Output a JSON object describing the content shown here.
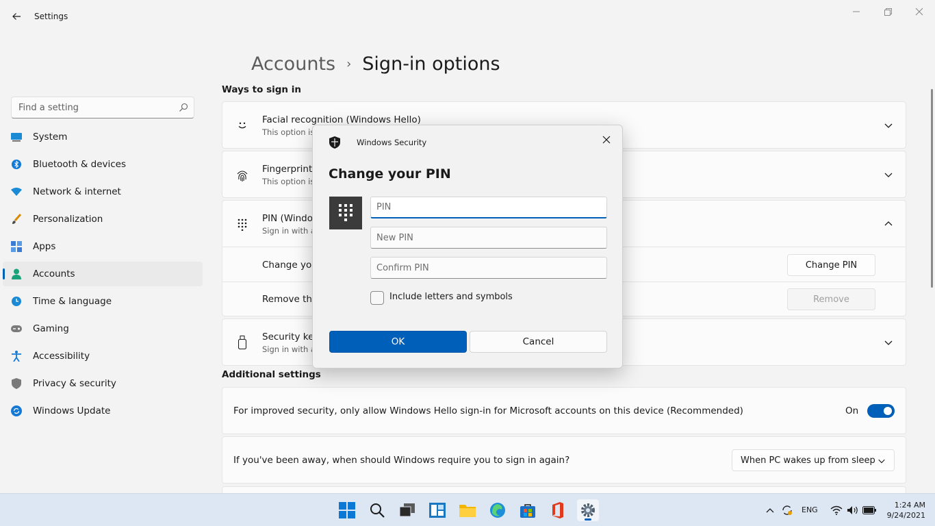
{
  "window": {
    "app_title": "Settings"
  },
  "sidebar": {
    "search_placeholder": "Find a setting",
    "items": [
      {
        "label": "System",
        "icon": "monitor-icon"
      },
      {
        "label": "Bluetooth & devices",
        "icon": "bluetooth-icon"
      },
      {
        "label": "Network & internet",
        "icon": "wifi-icon"
      },
      {
        "label": "Personalization",
        "icon": "brush-icon"
      },
      {
        "label": "Apps",
        "icon": "apps-icon"
      },
      {
        "label": "Accounts",
        "icon": "person-icon",
        "active": true
      },
      {
        "label": "Time & language",
        "icon": "clock-globe-icon"
      },
      {
        "label": "Gaming",
        "icon": "gamepad-icon"
      },
      {
        "label": "Accessibility",
        "icon": "accessibility-icon"
      },
      {
        "label": "Privacy & security",
        "icon": "shield-icon"
      },
      {
        "label": "Windows Update",
        "icon": "update-icon"
      }
    ]
  },
  "breadcrumb": {
    "parent": "Accounts",
    "separator": "›",
    "current": "Sign-in options"
  },
  "ways": {
    "heading": "Ways to sign in",
    "facial": {
      "title": "Facial recognition (Windows Hello)",
      "sub": "This option is"
    },
    "fingerprint": {
      "title": "Fingerprint r",
      "sub": "This option is"
    },
    "pin": {
      "title": "PIN (Windo",
      "sub": "Sign in with a",
      "change_label": "Change you",
      "change_button": "Change PIN",
      "remove_label": "Remove this",
      "remove_button": "Remove"
    },
    "security_key": {
      "title": "Security key",
      "sub": "Sign in with a"
    }
  },
  "additional": {
    "heading": "Additional settings",
    "hello_only": {
      "text": "For improved security, only allow Windows Hello sign-in for Microsoft accounts on this device (Recommended)",
      "state_label": "On",
      "enabled": true
    },
    "away": {
      "text": "If you've been away, when should Windows require you to sign in again?",
      "value": "When PC wakes up from sleep"
    }
  },
  "dialog": {
    "app_name": "Windows Security",
    "title": "Change your PIN",
    "pin_placeholder": "PIN",
    "new_pin_placeholder": "New PIN",
    "confirm_pin_placeholder": "Confirm PIN",
    "include_label": "Include letters and symbols",
    "ok": "OK",
    "cancel": "Cancel"
  },
  "taskbar": {
    "language": "ENG",
    "time": "1:24 AM",
    "date": "9/24/2021"
  },
  "colors": {
    "accent": "#005fb8",
    "taskbar": "#dde6f3"
  }
}
